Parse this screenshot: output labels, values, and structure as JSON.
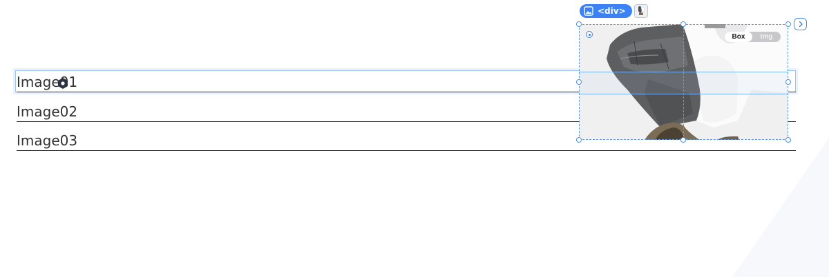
{
  "list": {
    "rows": [
      {
        "label": "Image01"
      },
      {
        "label": "Image02"
      },
      {
        "label": "Image03"
      }
    ]
  },
  "inspector": {
    "element_tag": "<div>",
    "toggle": {
      "options": [
        "Box",
        "Img"
      ],
      "selected": "Box"
    },
    "colors": {
      "accent": "#3b82f6",
      "selection_border": "#5b9ae8",
      "row_outline": "#9ec3f4",
      "toggle_track": "#c8c8cb"
    }
  },
  "icons": {
    "tag": "image-icon",
    "thumb": "image-thumbnail-icon",
    "expand": "chevron-right-icon",
    "cursor": "hexagon-cursor-icon",
    "anchor": "target-dot-icon"
  }
}
